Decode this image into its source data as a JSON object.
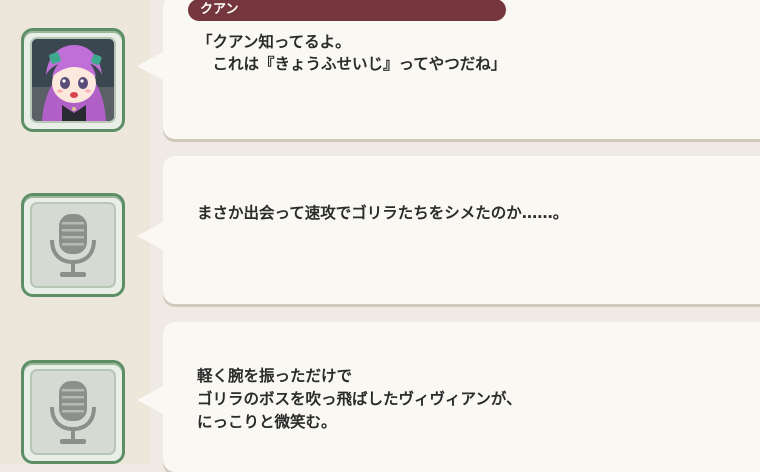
{
  "entries": [
    {
      "speaker": "クアン",
      "lines": [
        "「クアン知ってるよ。",
        "　これは『きょうふせいじ』ってやつだね」"
      ],
      "portrait": "character-portrait"
    },
    {
      "speaker": "",
      "lines": [
        "まさか出会って速攻でゴリラたちをシメたのか……。"
      ],
      "portrait": "microphone-icon"
    },
    {
      "speaker": "",
      "lines": [
        "軽く腕を振っただけで",
        "ゴリラのボスを吹っ飛ばしたヴィヴィアンが、",
        "にっこりと微笑む。"
      ],
      "portrait": "microphone-icon"
    }
  ],
  "colors": {
    "nameplate": "#75373d",
    "frame": "#5c8f66",
    "bubble": "#faf8f3",
    "background": "#efebe4"
  }
}
